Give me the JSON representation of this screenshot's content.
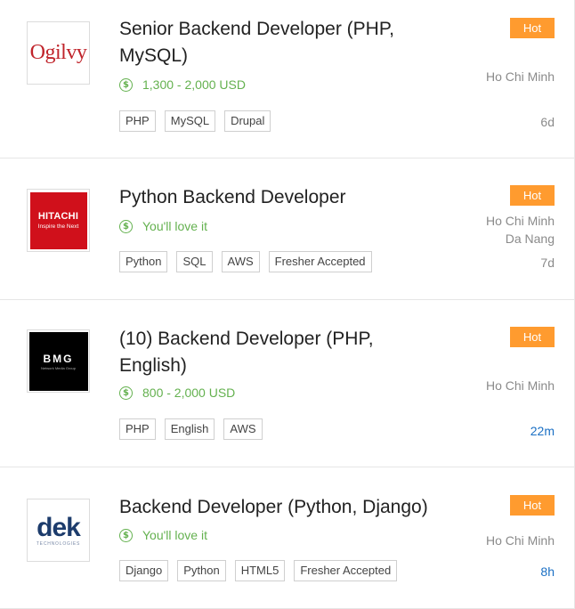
{
  "jobs": [
    {
      "company_logo": {
        "text": "Ogilvy"
      },
      "title_line1": "Senior Backend Developer (PHP,",
      "title_line2": "MySQL)",
      "salary": "1,300 - 2,000 USD",
      "tags": [
        "PHP",
        "MySQL",
        "Drupal"
      ],
      "badge": "Hot",
      "locations": [
        "Ho Chi Minh"
      ],
      "posted": "6d"
    },
    {
      "company_logo": {
        "text": "HITACHI",
        "subtext": "Inspire the Next"
      },
      "title_line1": "Python Backend Developer",
      "salary": "You'll love it",
      "tags": [
        "Python",
        "SQL",
        "AWS",
        "Fresher Accepted"
      ],
      "badge": "Hot",
      "locations": [
        "Ho Chi Minh",
        "Da Nang"
      ],
      "posted": "7d"
    },
    {
      "company_logo": {
        "text": "BMG",
        "subtext": "Network Media Group"
      },
      "title_line1": "(10) Backend Developer (PHP,",
      "title_line2": "English)",
      "salary": "800 - 2,000 USD",
      "tags": [
        "PHP",
        "English",
        "AWS"
      ],
      "badge": "Hot",
      "locations": [
        "Ho Chi Minh"
      ],
      "posted": "22m"
    },
    {
      "company_logo": {
        "text": "dek",
        "subtext": "TECHNOLOGIES"
      },
      "title_line1": "Backend Developer (Python, Django)",
      "salary": "You'll love it",
      "tags": [
        "Django",
        "Python",
        "HTML5",
        "Fresher Accepted"
      ],
      "badge": "Hot",
      "locations": [
        "Ho Chi Minh"
      ],
      "posted": "8h"
    }
  ],
  "colors": {
    "hot_badge": "#ff9b2f",
    "salary_green": "#64b14f",
    "recent_time_blue": "#1a6fc4",
    "muted_text": "#8a8a8a"
  },
  "icons": {
    "salary": "dollar-circle-icon"
  }
}
